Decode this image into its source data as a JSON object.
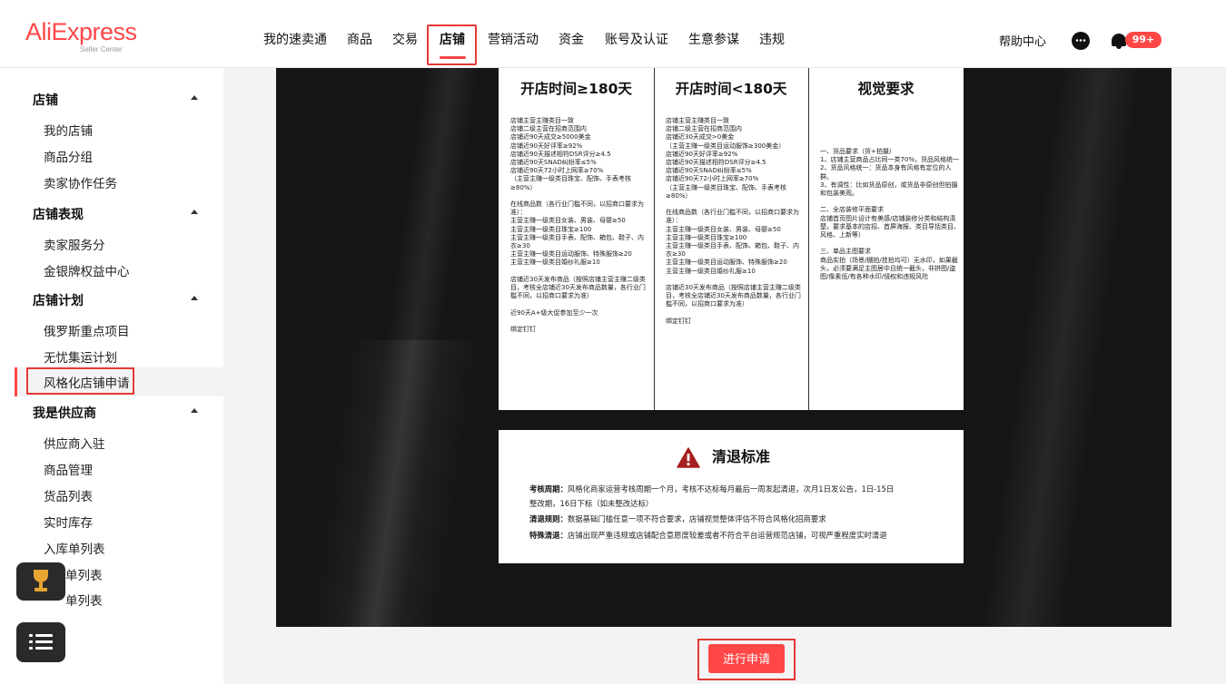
{
  "logo": {
    "brand": "AliExpress",
    "sub": "Seller Center"
  },
  "nav": {
    "items": [
      "我的速卖通",
      "商品",
      "交易",
      "店铺",
      "营销活动",
      "资金",
      "账号及认证",
      "生意参谋",
      "违规"
    ],
    "active": "店铺",
    "help": "帮助中心",
    "badge": "99+",
    "accent": "#ff4747"
  },
  "sidebar": {
    "groups": [
      {
        "title": "店铺",
        "items": [
          "我的店铺",
          "商品分组",
          "卖家协作任务"
        ]
      },
      {
        "title": "店铺表现",
        "items": [
          "卖家服务分",
          "金银牌权益中心"
        ]
      },
      {
        "title": "店铺计划",
        "items": [
          "俄罗斯重点项目",
          "无忧集运计划",
          "风格化店铺申请"
        ]
      },
      {
        "title": "我是供应商",
        "items": [
          "供应商入驻",
          "商品管理",
          "货品列表",
          "实时库存",
          "入库单列表",
          "单列表",
          "单列表"
        ]
      }
    ],
    "active_item": "风格化店铺申请"
  },
  "table": {
    "col1": {
      "title": "开店时间≥180天",
      "text": "店铺主营主赚类目一致\n店铺二级主营在招商范围内\n店铺近90天成交≥5000美金\n店铺近90天好评率≥92%\n店铺近90天描述相符DSR评分≥4.5\n店铺近90天SNAD纠纷率≤5%\n店铺近90天72小时上网率≥70%\n（主营主赚一级类目珠宝、配饰、手表考核≥80%）\n\n在线商品数（各行业门槛不同，以招商口要求为准）：\n主营主赚一级类目女装、男装、母婴≥50\n主营主赚一级类目珠宝≥100\n主营主赚一级类目手表、配饰、箱包、鞋子、内衣≥30\n主营主赚一级类目运动服饰、特殊服饰≥20\n主营主赚一级类目婚纱礼服≥10\n\n店铺近30天发布商品（按照店铺主营主赚二级类目，考核全店铺近30天发布商品数量，各行业门槛不同，以招商口要求为准）\n\n近90天A+级大促参加至少一次\n\n绑定钉钉"
    },
    "col2": {
      "title": "开店时间<180天",
      "text": "店铺主营主赚类目一致\n店铺二级主营在招商范围内\n店铺近30天成交>0美金\n（主营主赚一级类目运动服饰≥300美金）\n店铺近90天好评率≥92%\n店铺近90天描述相符DSR评分≥4.5\n店铺近90天SNAD纠纷率≤5%\n店铺近90天72小时上网率≥70%\n（主营主赚一级类目珠宝、配饰、手表考核≥80%）\n\n在线商品数（各行业门槛不同，以招商口要求为准）：\n主营主赚一级类目女装、男装、母婴≥50\n主营主赚一级类目珠宝≥100\n主营主赚一级类目手表、配饰、箱包、鞋子、内衣≥30\n主营主赚一级类目运动服饰、特殊服饰≥20\n主营主赚一级类目婚纱礼服≥10\n\n店铺近30天发布商品（按照店铺主营主赚二级类目，考核全店铺近30天发布商品数量，各行业门槛不同，以招商口要求为准）\n\n绑定钉钉"
    },
    "col3": {
      "title": "视觉要求",
      "text": "一、货品要求（货+拍摄）\n1、店铺主营商品占比同一类70%，货品风格统一\n2、货品风格统一：货品本身有风格有定位的人群。\n3、有调性：比如货品原创，或货品非原创但拍摄和包装美观。\n\n二、全店装修平面要求\n店铺首页图片设计有美感/店铺装修分类和结构清楚，要求基本的店招、首屏海报、类目导括类目、风格、上新等）\n\n三、单品主图要求\n商品实拍（场景/棚拍/挂拍均可）无水印，如果截头，必须要满足主图居中且统一截头，非拼图/盗图/像素低/有各种水印/侵权和违规风险"
    }
  },
  "clearance": {
    "title": "清退标准",
    "period_label": "考核周期：",
    "period_text1": "风格化商家运营考核周期一个月，考核不达标每月最后一周发起清退，次月1日发公告，1日-15日",
    "period_text2": "整改期，16日下标（如未整改达标）",
    "rule_label": "清退规则：",
    "rule_text": "数据基础门槛任意一项不符合要求，店铺视觉整体评估不符合风格化招商要求",
    "special_label": "特殊清退：",
    "special_text": "店铺出现严重违规或店铺配合意愿度较差或者不符合平台运营规范店铺，可视严重程度实时清退"
  },
  "apply_button": "进行申请",
  "colors": {
    "brand": "#ff4747",
    "warning_icon": "#a82020",
    "content_bg": "#161616"
  }
}
